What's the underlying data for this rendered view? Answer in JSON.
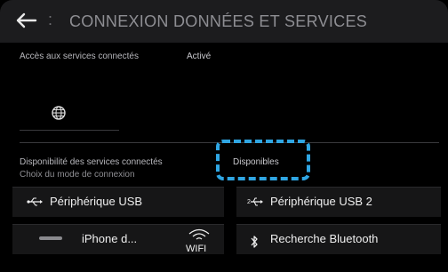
{
  "header": {
    "title": "CONNEXION DONNÉES ET SERVICES",
    "separator": ":"
  },
  "services": {
    "label": "Accès aux services connectés",
    "value": "Activé"
  },
  "availability": {
    "label": "Disponibilité des services connectés",
    "sublabel": "Choix du mode de connexion",
    "value": "Disponibles"
  },
  "options": {
    "usb1": "Périphérique USB",
    "usb2": "Périphérique USB 2",
    "iphone": "iPhone d...",
    "wifi": "WIFI",
    "bluetooth": "Recherche Bluetooth"
  },
  "colors": {
    "highlight": "#2fa6e3",
    "titlebar": "#1c1c1e",
    "background": "#000000"
  },
  "icons": [
    "back-arrow-icon",
    "globe-icon",
    "usb-icon",
    "usb2-icon",
    "wifi-icon",
    "bluetooth-icon"
  ]
}
